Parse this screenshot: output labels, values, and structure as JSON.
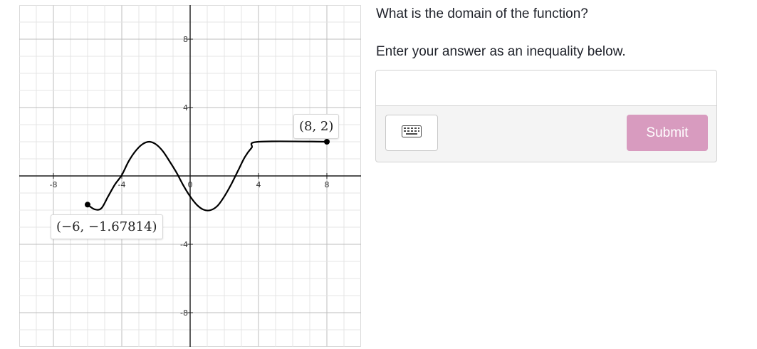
{
  "question": {
    "prompt": "What is the domain of the function?",
    "instruction": "Enter your answer as an inequality below."
  },
  "answer": {
    "input_value": "",
    "placeholder": "",
    "keyboard_icon": "keyboard-icon",
    "submit_label": "Submit"
  },
  "colors": {
    "submit_button": "#d89bbf",
    "curve": "#000000",
    "panel_background": "#f4f4f4"
  },
  "chart_data": {
    "type": "line",
    "grid": true,
    "minor_grid_step": 1,
    "major_grid_step": 4,
    "xlim": [
      -10,
      10
    ],
    "ylim": [
      -10,
      10
    ],
    "x_tick_labels": [
      "-8",
      "-4",
      "0",
      "4",
      "8"
    ],
    "y_tick_labels": [
      "8",
      "4",
      "-4",
      "-8"
    ],
    "series": [
      {
        "points": [
          [
            -6,
            -1.67814
          ],
          [
            -5.6,
            -1.95
          ],
          [
            -5.2,
            -1.9
          ],
          [
            -4.8,
            -1.2
          ],
          [
            -4.4,
            -0.5
          ],
          [
            -4.0,
            0.05
          ],
          [
            -3.6,
            0.85
          ],
          [
            -3.2,
            1.45
          ],
          [
            -2.8,
            1.85
          ],
          [
            -2.4,
            2.0
          ],
          [
            -2.0,
            1.85
          ],
          [
            -1.6,
            1.45
          ],
          [
            -1.2,
            0.85
          ],
          [
            -0.8,
            0.2
          ],
          [
            -0.4,
            -0.55
          ],
          [
            0.0,
            -1.2
          ],
          [
            0.4,
            -1.7
          ],
          [
            0.8,
            -1.98
          ],
          [
            1.2,
            -2.0
          ],
          [
            1.6,
            -1.75
          ],
          [
            2.0,
            -1.2
          ],
          [
            2.4,
            -0.5
          ],
          [
            2.8,
            0.3
          ],
          [
            3.2,
            1.1
          ],
          [
            3.6,
            1.65
          ],
          [
            4.0,
            2.0
          ],
          [
            8.0,
            2.0
          ]
        ]
      }
    ],
    "endpoints": [
      [
        -6,
        -1.67814
      ],
      [
        8,
        2
      ]
    ],
    "annotations": [
      "(−6, −1.67814)",
      "(8, 2)"
    ]
  }
}
